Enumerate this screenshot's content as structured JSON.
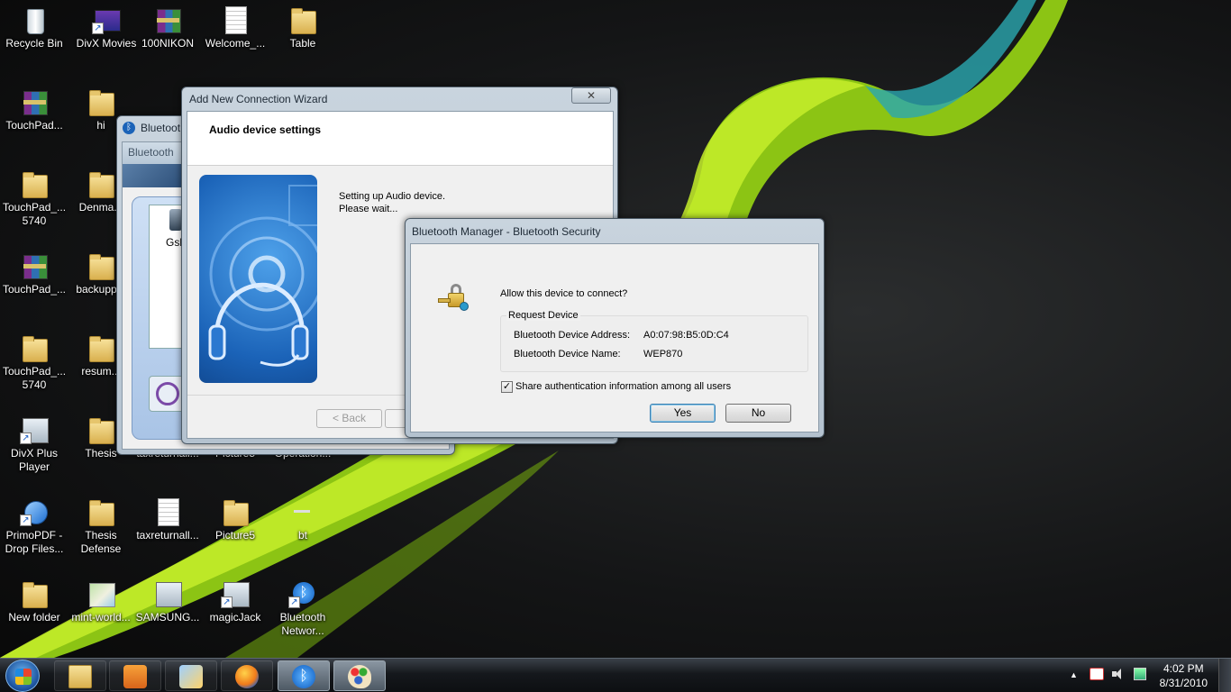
{
  "desktop_icons": [
    {
      "label": "Recycle Bin"
    },
    {
      "label": "DivX Movies"
    },
    {
      "label": "100NIKON"
    },
    {
      "label": "Welcome_..."
    },
    {
      "label": "Table"
    },
    {
      "label": "TouchPad..."
    },
    {
      "label": "hi"
    },
    {
      "label": "TouchPad_... 5740"
    },
    {
      "label": "Denma..."
    },
    {
      "label": "TouchPad_..."
    },
    {
      "label": "backupp..."
    },
    {
      "label": "TouchPad_... 5740"
    },
    {
      "label": "resum..."
    },
    {
      "label": "DivX Plus Player"
    },
    {
      "label": "Thesis"
    },
    {
      "label": "taxreturnall..."
    },
    {
      "label": "Picture5"
    },
    {
      "label": "Operation..."
    },
    {
      "label": "PrimoPDF - Drop Files..."
    },
    {
      "label": "Thesis Defense"
    },
    {
      "label": "taxreturnall..."
    },
    {
      "label": "Picture5"
    },
    {
      "label": "bt"
    },
    {
      "label": "New folder"
    },
    {
      "label": "mint-world..."
    },
    {
      "label": "SAMSUNG..."
    },
    {
      "label": "magicJack"
    },
    {
      "label": "Bluetooth Networ..."
    }
  ],
  "bt_window": {
    "title": "Bluetoot",
    "subtitle": "Bluetooth",
    "device_label": "Gsk"
  },
  "wizard": {
    "title": "Add New Connection Wizard",
    "close_glyph": "✕",
    "heading": "Audio device settings",
    "status_line1": "Setting up Audio device.",
    "status_line2": "Please wait...",
    "back_label": "< Back"
  },
  "security_dialog": {
    "title": "Bluetooth Manager - Bluetooth Security",
    "question": "Allow this device to connect?",
    "group_label": "Request Device",
    "address_label": "Bluetooth Device Address:",
    "address_value": "A0:07:98:B5:0D:C4",
    "name_label": "Bluetooth Device Name:",
    "name_value": "WEP870",
    "share_checkbox_label": "Share authentication information among all users",
    "share_checked": true,
    "yes_label": "Yes",
    "no_label": "No"
  },
  "taskbar": {
    "start_icon": "windows-orb",
    "pinned": [
      "explorer-icon",
      "media-player-icon",
      "paint-icon",
      "firefox-icon",
      "bluetooth-icon",
      "paint-palette-icon"
    ],
    "tray_arrow": "▲",
    "clock_time": "4:02 PM",
    "clock_date": "8/31/2010"
  },
  "colors": {
    "wallpaper_swoosh": "#9acd16",
    "wallpaper_swoosh_light": "#c8f22a",
    "accent_blue": "#1b63b8"
  }
}
